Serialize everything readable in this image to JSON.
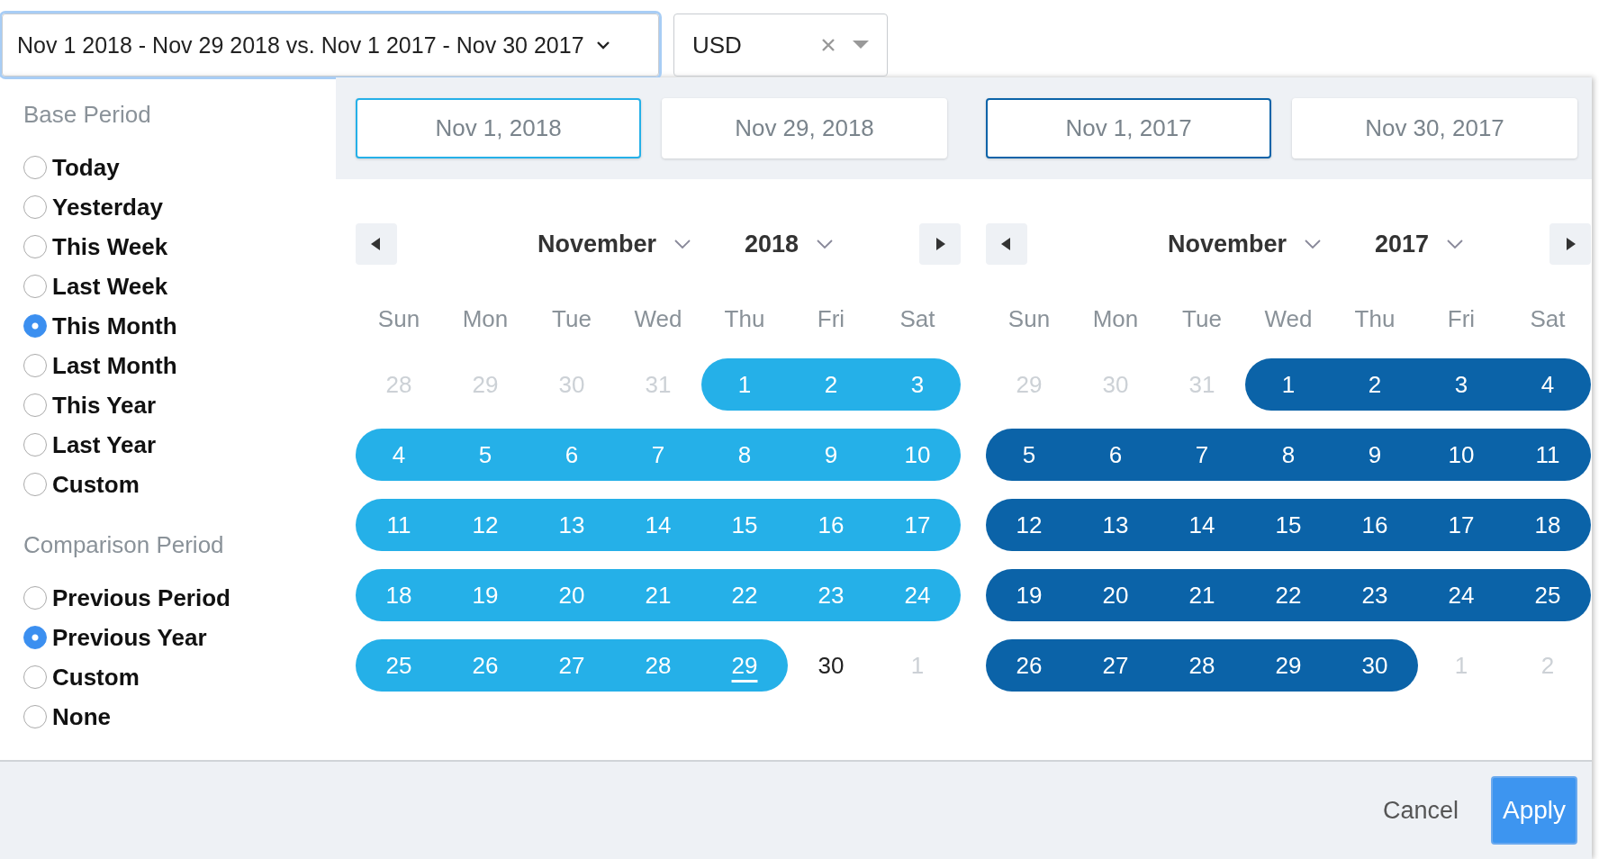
{
  "range_dropdown": {
    "value": "Nov 1 2018 - Nov 29 2018 vs. Nov 1 2017 - Nov 30 2017"
  },
  "currency_select": {
    "value": "USD"
  },
  "sidebar": [
    {
      "title": "Base Period",
      "options": [
        {
          "label": "Today",
          "selected": false
        },
        {
          "label": "Yesterday",
          "selected": false
        },
        {
          "label": "This Week",
          "selected": false
        },
        {
          "label": "Last Week",
          "selected": false
        },
        {
          "label": "This Month",
          "selected": true
        },
        {
          "label": "Last Month",
          "selected": false
        },
        {
          "label": "This Year",
          "selected": false
        },
        {
          "label": "Last Year",
          "selected": false
        },
        {
          "label": "Custom",
          "selected": false
        }
      ]
    },
    {
      "title": "Comparison Period",
      "options": [
        {
          "label": "Previous Period",
          "selected": false
        },
        {
          "label": "Previous Year",
          "selected": true
        },
        {
          "label": "Custom",
          "selected": false
        },
        {
          "label": "None",
          "selected": false
        }
      ]
    }
  ],
  "calendars": [
    {
      "color": "#25b0e8",
      "start": {
        "value": "Nov 1, 2018",
        "focused": true
      },
      "end": {
        "value": "Nov 29, 2018",
        "focused": false
      },
      "month": "November",
      "year": "2018",
      "weekdays": [
        "Sun",
        "Mon",
        "Tue",
        "Wed",
        "Thu",
        "Fri",
        "Sat"
      ],
      "weeks": [
        [
          {
            "label": "28",
            "kind": "muted",
            "selected": false
          },
          {
            "label": "29",
            "kind": "muted",
            "selected": false
          },
          {
            "label": "30",
            "kind": "muted",
            "selected": false
          },
          {
            "label": "31",
            "kind": "muted",
            "selected": false
          },
          {
            "label": "1",
            "kind": "normal",
            "selected": true
          },
          {
            "label": "2",
            "kind": "normal",
            "selected": true
          },
          {
            "label": "3",
            "kind": "normal",
            "selected": true
          }
        ],
        [
          {
            "label": "4",
            "kind": "normal",
            "selected": true
          },
          {
            "label": "5",
            "kind": "normal",
            "selected": true
          },
          {
            "label": "6",
            "kind": "normal",
            "selected": true
          },
          {
            "label": "7",
            "kind": "normal",
            "selected": true
          },
          {
            "label": "8",
            "kind": "normal",
            "selected": true
          },
          {
            "label": "9",
            "kind": "normal",
            "selected": true
          },
          {
            "label": "10",
            "kind": "normal",
            "selected": true
          }
        ],
        [
          {
            "label": "11",
            "kind": "normal",
            "selected": true
          },
          {
            "label": "12",
            "kind": "normal",
            "selected": true
          },
          {
            "label": "13",
            "kind": "normal",
            "selected": true
          },
          {
            "label": "14",
            "kind": "normal",
            "selected": true
          },
          {
            "label": "15",
            "kind": "normal",
            "selected": true
          },
          {
            "label": "16",
            "kind": "normal",
            "selected": true
          },
          {
            "label": "17",
            "kind": "normal",
            "selected": true
          }
        ],
        [
          {
            "label": "18",
            "kind": "normal",
            "selected": true
          },
          {
            "label": "19",
            "kind": "normal",
            "selected": true
          },
          {
            "label": "20",
            "kind": "normal",
            "selected": true
          },
          {
            "label": "21",
            "kind": "normal",
            "selected": true
          },
          {
            "label": "22",
            "kind": "normal",
            "selected": true
          },
          {
            "label": "23",
            "kind": "normal",
            "selected": true
          },
          {
            "label": "24",
            "kind": "normal",
            "selected": true
          }
        ],
        [
          {
            "label": "25",
            "kind": "normal",
            "selected": true
          },
          {
            "label": "26",
            "kind": "normal",
            "selected": true
          },
          {
            "label": "27",
            "kind": "normal",
            "selected": true
          },
          {
            "label": "28",
            "kind": "normal",
            "selected": true
          },
          {
            "label": "29",
            "kind": "today",
            "selected": true
          },
          {
            "label": "30",
            "kind": "normal",
            "selected": false
          },
          {
            "label": "1",
            "kind": "muted",
            "selected": false
          }
        ]
      ]
    },
    {
      "color": "#0b63a8",
      "start": {
        "value": "Nov 1, 2017",
        "focused": true
      },
      "end": {
        "value": "Nov 30, 2017",
        "focused": false
      },
      "month": "November",
      "year": "2017",
      "weekdays": [
        "Sun",
        "Mon",
        "Tue",
        "Wed",
        "Thu",
        "Fri",
        "Sat"
      ],
      "weeks": [
        [
          {
            "label": "29",
            "kind": "muted",
            "selected": false
          },
          {
            "label": "30",
            "kind": "muted",
            "selected": false
          },
          {
            "label": "31",
            "kind": "muted",
            "selected": false
          },
          {
            "label": "1",
            "kind": "normal",
            "selected": true
          },
          {
            "label": "2",
            "kind": "normal",
            "selected": true
          },
          {
            "label": "3",
            "kind": "normal",
            "selected": true
          },
          {
            "label": "4",
            "kind": "normal",
            "selected": true
          }
        ],
        [
          {
            "label": "5",
            "kind": "normal",
            "selected": true
          },
          {
            "label": "6",
            "kind": "normal",
            "selected": true
          },
          {
            "label": "7",
            "kind": "normal",
            "selected": true
          },
          {
            "label": "8",
            "kind": "normal",
            "selected": true
          },
          {
            "label": "9",
            "kind": "normal",
            "selected": true
          },
          {
            "label": "10",
            "kind": "normal",
            "selected": true
          },
          {
            "label": "11",
            "kind": "normal",
            "selected": true
          }
        ],
        [
          {
            "label": "12",
            "kind": "normal",
            "selected": true
          },
          {
            "label": "13",
            "kind": "normal",
            "selected": true
          },
          {
            "label": "14",
            "kind": "normal",
            "selected": true
          },
          {
            "label": "15",
            "kind": "normal",
            "selected": true
          },
          {
            "label": "16",
            "kind": "normal",
            "selected": true
          },
          {
            "label": "17",
            "kind": "normal",
            "selected": true
          },
          {
            "label": "18",
            "kind": "normal",
            "selected": true
          }
        ],
        [
          {
            "label": "19",
            "kind": "normal",
            "selected": true
          },
          {
            "label": "20",
            "kind": "normal",
            "selected": true
          },
          {
            "label": "21",
            "kind": "normal",
            "selected": true
          },
          {
            "label": "22",
            "kind": "normal",
            "selected": true
          },
          {
            "label": "23",
            "kind": "normal",
            "selected": true
          },
          {
            "label": "24",
            "kind": "normal",
            "selected": true
          },
          {
            "label": "25",
            "kind": "normal",
            "selected": true
          }
        ],
        [
          {
            "label": "26",
            "kind": "normal",
            "selected": true
          },
          {
            "label": "27",
            "kind": "normal",
            "selected": true
          },
          {
            "label": "28",
            "kind": "normal",
            "selected": true
          },
          {
            "label": "29",
            "kind": "normal",
            "selected": true
          },
          {
            "label": "30",
            "kind": "normal",
            "selected": true
          },
          {
            "label": "1",
            "kind": "muted",
            "selected": false
          },
          {
            "label": "2",
            "kind": "muted",
            "selected": false
          }
        ]
      ]
    }
  ],
  "footer": {
    "cancel": "Cancel",
    "apply": "Apply"
  }
}
